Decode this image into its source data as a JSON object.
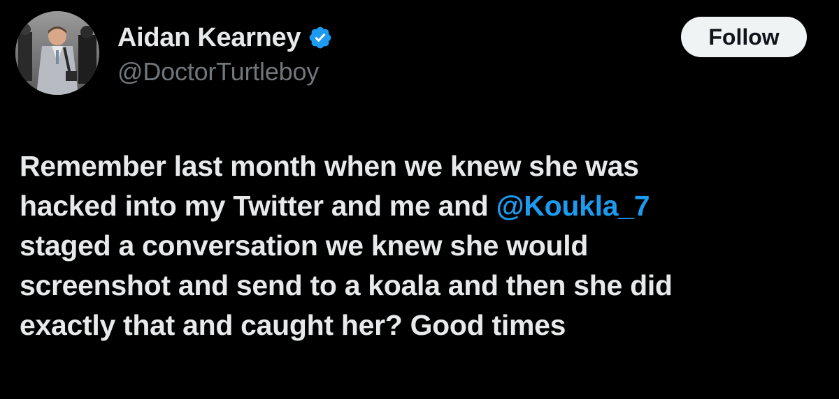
{
  "author": {
    "display_name": "Aidan Kearney",
    "handle": "@DoctorTurtleboy",
    "verified": true,
    "verified_color": "#1d9bf0",
    "avatar_icon": "profile-photo"
  },
  "follow_button": {
    "label": "Follow"
  },
  "tweet": {
    "lines": [
      {
        "before": "Remember last month when we knew she was"
      },
      {
        "before": "hacked into my Twitter and me and ",
        "mention": "@Koukla_7"
      },
      {
        "before": "staged a conversation we knew she would"
      },
      {
        "before": "screenshot and send to a koala and then she did"
      },
      {
        "before": "exactly that and caught her? Good times"
      }
    ]
  },
  "colors": {
    "background": "#000000",
    "text": "#e7e9ea",
    "secondary_text": "#71767b",
    "link": "#1d9bf0",
    "button_bg": "#eff3f4",
    "button_text": "#0f1419"
  }
}
